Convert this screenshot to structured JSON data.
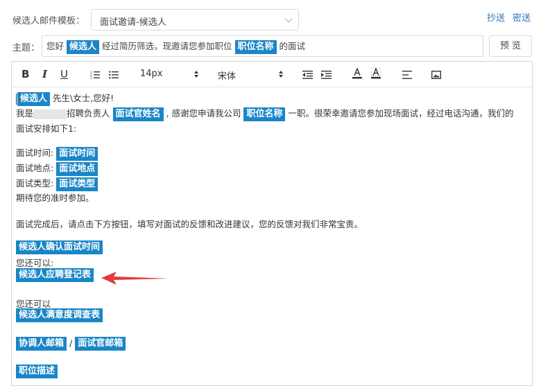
{
  "template_label": "候选人邮件模板：",
  "template_value": "面试邀请-候选人",
  "cc": "抄送",
  "bcc": "密送",
  "subject_label": "主题：",
  "subject": {
    "part1": "您好",
    "tag1": "候选人",
    "part2": "经过简历筛选，现邀请您参加职位",
    "tag2": "职位名称",
    "part3": "的面试"
  },
  "preview_btn": "预 览",
  "toolbar": {
    "bold": "B",
    "italic": "I",
    "underline": "U",
    "font_size": "14px",
    "font_family": "宋体"
  },
  "body": {
    "greet_tag": "候选人",
    "greet_text": "先生\\女士,您好!",
    "intro_a": "我是",
    "intro_b": "招聘负责人",
    "tag_interviewer": "面试官姓名",
    "intro_c": ", 感谢您申请我公司",
    "tag_position": "职位名称",
    "intro_d": "一职。很荣幸邀请您参加现场面试，经过电话沟通，我们的",
    "intro_e": "面试安排如下1:",
    "time_label": "面试时间:",
    "time_tag": "面试时间",
    "place_label": "面试地点:",
    "place_tag": "面试地点",
    "type_label": "面试类型:",
    "type_tag": "面试类型",
    "expect": "期待您的准时参加。",
    "after": "面试完成后，请点击下方按钮，填写对面试的反馈和改进建议，您的反馈对我们非常宝贵。",
    "btn_confirm": "候选人确认面试时间",
    "also1": "您还可以:",
    "btn_register": "候选人应聘登记表",
    "also2": "您还可以",
    "btn_survey": "候选人满意度调查表",
    "btn_coordinator": "协调人邮箱",
    "slash": "/",
    "btn_interviewer": "面试官邮箱",
    "btn_jd": "职位描述"
  },
  "colors": {
    "tag_bg": "#1a86c8",
    "link": "#2a74b8",
    "arrow": "#e23b3b"
  }
}
